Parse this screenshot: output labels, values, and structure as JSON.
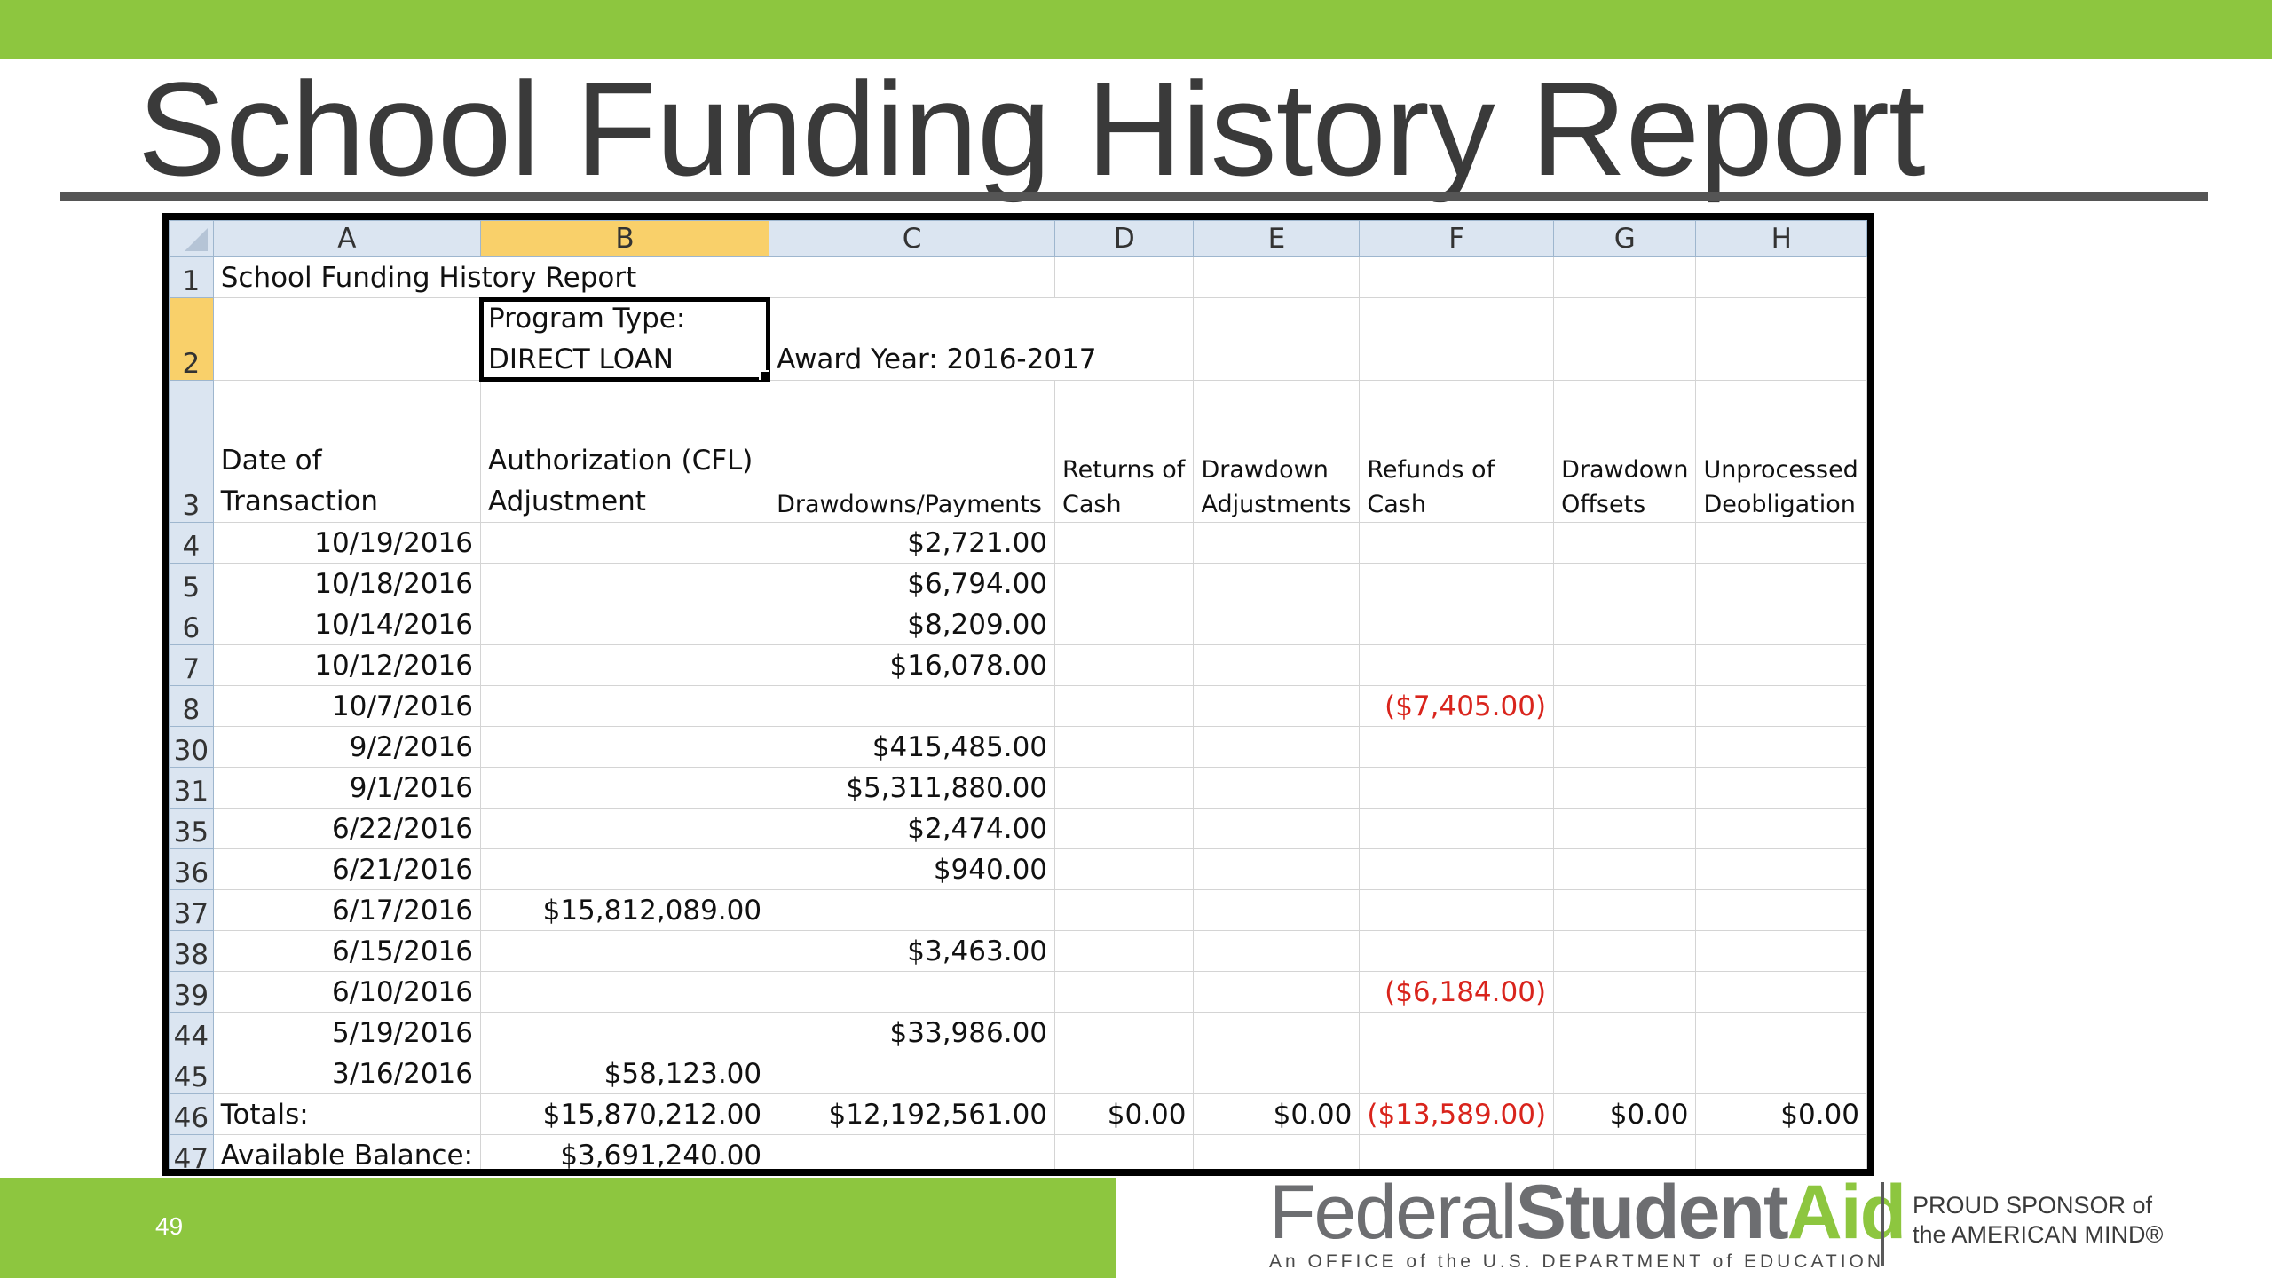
{
  "slide": {
    "title": "School Funding History Report",
    "page_number": "49",
    "logo": {
      "word1": "Federal",
      "word2": "Student",
      "word3": "Aid",
      "subtitle": "An OFFICE of the U.S. DEPARTMENT of EDUCATION"
    },
    "sponsor": {
      "line1": "PROUD SPONSOR of",
      "line2": "the AMERICAN MIND®"
    },
    "colors": {
      "green": "#8dc63f",
      "gray": "#555555",
      "negative": "#d9241c",
      "header_bg": "#dbe5f1",
      "selected_header": "#f9d06a"
    }
  },
  "sheet": {
    "columns": [
      "A",
      "B",
      "C",
      "D",
      "E",
      "F",
      "G",
      "H"
    ],
    "selected_column": "B",
    "row1": {
      "num": "1",
      "a": "School Funding History Report"
    },
    "row2": {
      "num": "2",
      "b_line1": "Program Type:",
      "b_line2": "DIRECT LOAN",
      "c": "Award Year: 2016-2017"
    },
    "row3": {
      "num": "3",
      "a_line1": "Date of",
      "a_line2": "Transaction",
      "b_line1": "Authorization (CFL)",
      "b_line2": "Adjustment",
      "c": "Drawdowns/Payments",
      "d_line1": "Returns of",
      "d_line2": "Cash",
      "e_line1": "Drawdown",
      "e_line2": "Adjustments",
      "f_line1": "Refunds of",
      "f_line2": "Cash",
      "g_line1": "Drawdown",
      "g_line2": "Offsets",
      "h_line1": "Unprocessed",
      "h_line2": "Deobligation"
    },
    "rows": [
      {
        "num": "4",
        "date": "10/19/2016",
        "b": "",
        "c": "$2,721.00",
        "f": ""
      },
      {
        "num": "5",
        "date": "10/18/2016",
        "b": "",
        "c": "$6,794.00",
        "f": ""
      },
      {
        "num": "6",
        "date": "10/14/2016",
        "b": "",
        "c": "$8,209.00",
        "f": ""
      },
      {
        "num": "7",
        "date": "10/12/2016",
        "b": "",
        "c": "$16,078.00",
        "f": ""
      },
      {
        "num": "8",
        "date": "10/7/2016",
        "b": "",
        "c": "",
        "f": "($7,405.00)"
      },
      {
        "num": "30",
        "date": "9/2/2016",
        "b": "",
        "c": "$415,485.00",
        "f": ""
      },
      {
        "num": "31",
        "date": "9/1/2016",
        "b": "",
        "c": "$5,311,880.00",
        "f": ""
      },
      {
        "num": "35",
        "date": "6/22/2016",
        "b": "",
        "c": "$2,474.00",
        "f": ""
      },
      {
        "num": "36",
        "date": "6/21/2016",
        "b": "",
        "c": "$940.00",
        "f": ""
      },
      {
        "num": "37",
        "date": "6/17/2016",
        "b": "$15,812,089.00",
        "c": "",
        "f": ""
      },
      {
        "num": "38",
        "date": "6/15/2016",
        "b": "",
        "c": "$3,463.00",
        "f": ""
      },
      {
        "num": "39",
        "date": "6/10/2016",
        "b": "",
        "c": "",
        "f": "($6,184.00)"
      },
      {
        "num": "44",
        "date": "5/19/2016",
        "b": "",
        "c": "$33,986.00",
        "f": ""
      },
      {
        "num": "45",
        "date": "3/16/2016",
        "b": "$58,123.00",
        "c": "",
        "f": ""
      }
    ],
    "totals": {
      "num": "46",
      "label": "Totals:",
      "b": "$15,870,212.00",
      "c": "$12,192,561.00",
      "d": "$0.00",
      "e": "$0.00",
      "f": "($13,589.00)",
      "g": "$0.00",
      "h": "$0.00"
    },
    "available": {
      "num": "47",
      "label": "Available Balance:",
      "b": "$3,691,240.00"
    }
  }
}
